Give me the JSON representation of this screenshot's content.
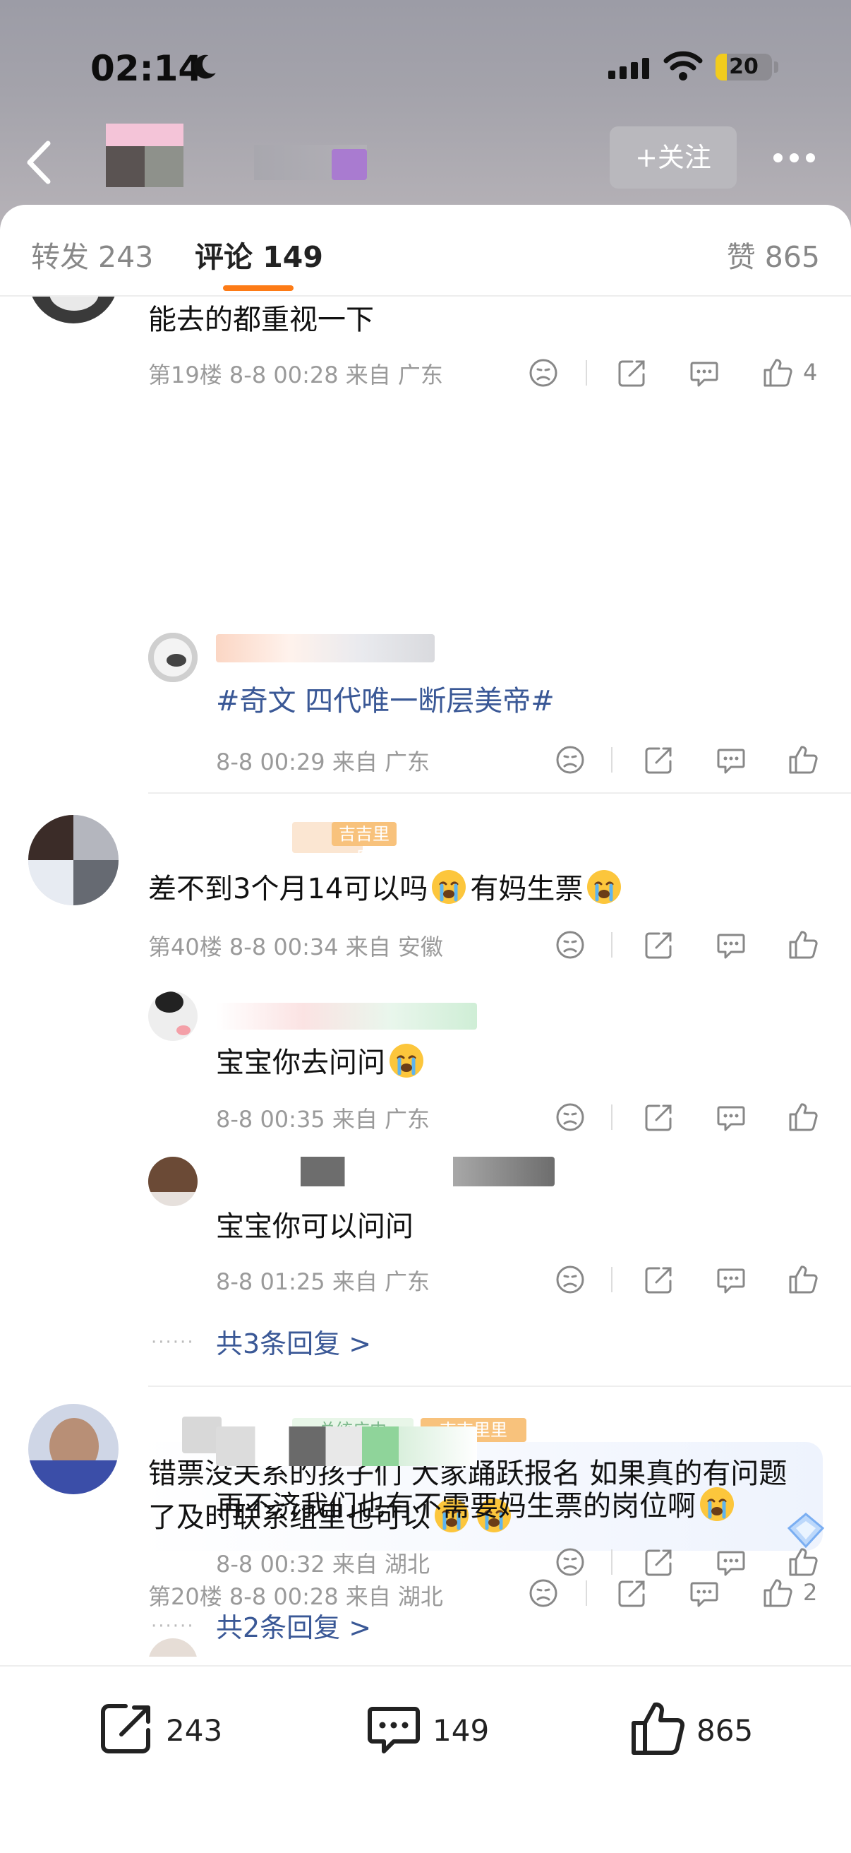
{
  "status_bar": {
    "time": "02:14",
    "battery": "20",
    "battery_level_pct": 20
  },
  "nav": {
    "follow_label": "+关注"
  },
  "tabs": {
    "repost": "转发 243",
    "comments": "评论 149",
    "likes": "赞 865"
  },
  "comments": [
    {
      "text": "能去的都重视一下",
      "floor": "第19楼",
      "time": "8-8 00:28",
      "location": "来自 广东",
      "likes": "4",
      "replies": [
        {
          "text": "#奇文 四代唯一断层美帝#",
          "time": "8-8 00:29",
          "location": "来自 广东"
        }
      ]
    },
    {
      "badge": "吉吉里里",
      "text": "差不到3个月14可以吗",
      "text_suffix": "有妈生票",
      "floor": "第40楼",
      "time": "8-8 00:34",
      "location": "来自 安徽",
      "replies": [
        {
          "text": "宝宝你去问问",
          "time": "8-8 00:35",
          "location": "来自 广东"
        },
        {
          "text": "宝宝你可以问问",
          "time": "8-8 01:25",
          "location": "来自 广东"
        }
      ],
      "more_replies": "共3条回复 >"
    },
    {
      "badges": [
        "总统广中",
        "吉吉里里"
      ],
      "text": "错票没关系的孩子们 大家踊跃报名 如果真的有问题了及时联系组里也可以",
      "floor": "第20楼",
      "time": "8-8 00:28",
      "location": "来自 湖北",
      "likes": "2",
      "replies": [
        {
          "text": "再不济我们也有不需要妈生票的岗位啊",
          "time": "8-8 00:32",
          "location": "来自 湖北"
        }
      ],
      "more_replies": "共2条回复 >"
    }
  ],
  "bottom_bar": {
    "reposts": "243",
    "comments": "149",
    "likes": "865"
  },
  "colors": {
    "accent": "#fd7b16",
    "link": "#3a5896",
    "meta": "#9a9a9a"
  },
  "icons": [
    "moon-icon",
    "back-icon",
    "more-icon",
    "dislike-icon",
    "share-icon",
    "comment-icon",
    "like-icon",
    "crying-emoji"
  ]
}
